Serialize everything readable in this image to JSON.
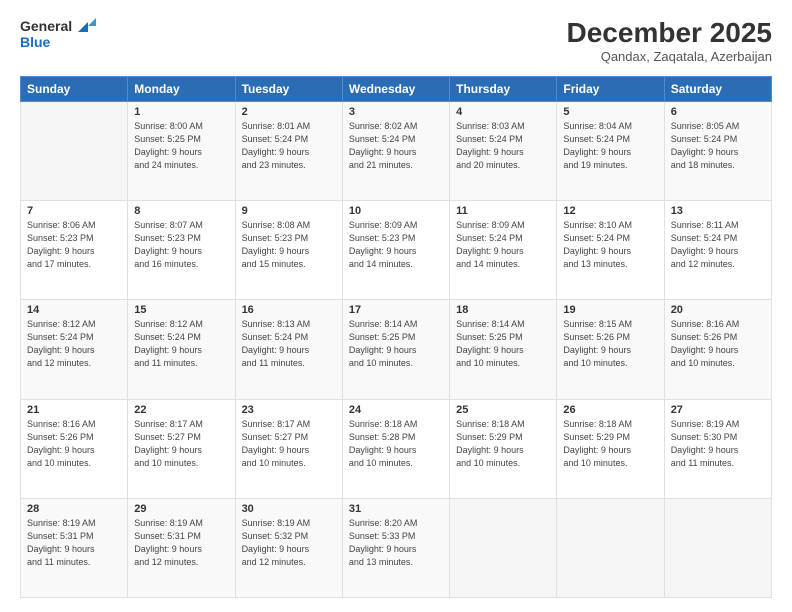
{
  "logo": {
    "line1": "General",
    "line2": "Blue"
  },
  "title": "December 2025",
  "location": "Qandax, Zaqatala, Azerbaijan",
  "days_of_week": [
    "Sunday",
    "Monday",
    "Tuesday",
    "Wednesday",
    "Thursday",
    "Friday",
    "Saturday"
  ],
  "weeks": [
    [
      {
        "day": "",
        "info": ""
      },
      {
        "day": "1",
        "info": "Sunrise: 8:00 AM\nSunset: 5:25 PM\nDaylight: 9 hours\nand 24 minutes."
      },
      {
        "day": "2",
        "info": "Sunrise: 8:01 AM\nSunset: 5:24 PM\nDaylight: 9 hours\nand 23 minutes."
      },
      {
        "day": "3",
        "info": "Sunrise: 8:02 AM\nSunset: 5:24 PM\nDaylight: 9 hours\nand 21 minutes."
      },
      {
        "day": "4",
        "info": "Sunrise: 8:03 AM\nSunset: 5:24 PM\nDaylight: 9 hours\nand 20 minutes."
      },
      {
        "day": "5",
        "info": "Sunrise: 8:04 AM\nSunset: 5:24 PM\nDaylight: 9 hours\nand 19 minutes."
      },
      {
        "day": "6",
        "info": "Sunrise: 8:05 AM\nSunset: 5:24 PM\nDaylight: 9 hours\nand 18 minutes."
      }
    ],
    [
      {
        "day": "7",
        "info": "Sunrise: 8:06 AM\nSunset: 5:23 PM\nDaylight: 9 hours\nand 17 minutes."
      },
      {
        "day": "8",
        "info": "Sunrise: 8:07 AM\nSunset: 5:23 PM\nDaylight: 9 hours\nand 16 minutes."
      },
      {
        "day": "9",
        "info": "Sunrise: 8:08 AM\nSunset: 5:23 PM\nDaylight: 9 hours\nand 15 minutes."
      },
      {
        "day": "10",
        "info": "Sunrise: 8:09 AM\nSunset: 5:23 PM\nDaylight: 9 hours\nand 14 minutes."
      },
      {
        "day": "11",
        "info": "Sunrise: 8:09 AM\nSunset: 5:24 PM\nDaylight: 9 hours\nand 14 minutes."
      },
      {
        "day": "12",
        "info": "Sunrise: 8:10 AM\nSunset: 5:24 PM\nDaylight: 9 hours\nand 13 minutes."
      },
      {
        "day": "13",
        "info": "Sunrise: 8:11 AM\nSunset: 5:24 PM\nDaylight: 9 hours\nand 12 minutes."
      }
    ],
    [
      {
        "day": "14",
        "info": "Sunrise: 8:12 AM\nSunset: 5:24 PM\nDaylight: 9 hours\nand 12 minutes."
      },
      {
        "day": "15",
        "info": "Sunrise: 8:12 AM\nSunset: 5:24 PM\nDaylight: 9 hours\nand 11 minutes."
      },
      {
        "day": "16",
        "info": "Sunrise: 8:13 AM\nSunset: 5:24 PM\nDaylight: 9 hours\nand 11 minutes."
      },
      {
        "day": "17",
        "info": "Sunrise: 8:14 AM\nSunset: 5:25 PM\nDaylight: 9 hours\nand 10 minutes."
      },
      {
        "day": "18",
        "info": "Sunrise: 8:14 AM\nSunset: 5:25 PM\nDaylight: 9 hours\nand 10 minutes."
      },
      {
        "day": "19",
        "info": "Sunrise: 8:15 AM\nSunset: 5:26 PM\nDaylight: 9 hours\nand 10 minutes."
      },
      {
        "day": "20",
        "info": "Sunrise: 8:16 AM\nSunset: 5:26 PM\nDaylight: 9 hours\nand 10 minutes."
      }
    ],
    [
      {
        "day": "21",
        "info": "Sunrise: 8:16 AM\nSunset: 5:26 PM\nDaylight: 9 hours\nand 10 minutes."
      },
      {
        "day": "22",
        "info": "Sunrise: 8:17 AM\nSunset: 5:27 PM\nDaylight: 9 hours\nand 10 minutes."
      },
      {
        "day": "23",
        "info": "Sunrise: 8:17 AM\nSunset: 5:27 PM\nDaylight: 9 hours\nand 10 minutes."
      },
      {
        "day": "24",
        "info": "Sunrise: 8:18 AM\nSunset: 5:28 PM\nDaylight: 9 hours\nand 10 minutes."
      },
      {
        "day": "25",
        "info": "Sunrise: 8:18 AM\nSunset: 5:29 PM\nDaylight: 9 hours\nand 10 minutes."
      },
      {
        "day": "26",
        "info": "Sunrise: 8:18 AM\nSunset: 5:29 PM\nDaylight: 9 hours\nand 10 minutes."
      },
      {
        "day": "27",
        "info": "Sunrise: 8:19 AM\nSunset: 5:30 PM\nDaylight: 9 hours\nand 11 minutes."
      }
    ],
    [
      {
        "day": "28",
        "info": "Sunrise: 8:19 AM\nSunset: 5:31 PM\nDaylight: 9 hours\nand 11 minutes."
      },
      {
        "day": "29",
        "info": "Sunrise: 8:19 AM\nSunset: 5:31 PM\nDaylight: 9 hours\nand 12 minutes."
      },
      {
        "day": "30",
        "info": "Sunrise: 8:19 AM\nSunset: 5:32 PM\nDaylight: 9 hours\nand 12 minutes."
      },
      {
        "day": "31",
        "info": "Sunrise: 8:20 AM\nSunset: 5:33 PM\nDaylight: 9 hours\nand 13 minutes."
      },
      {
        "day": "",
        "info": ""
      },
      {
        "day": "",
        "info": ""
      },
      {
        "day": "",
        "info": ""
      }
    ]
  ]
}
